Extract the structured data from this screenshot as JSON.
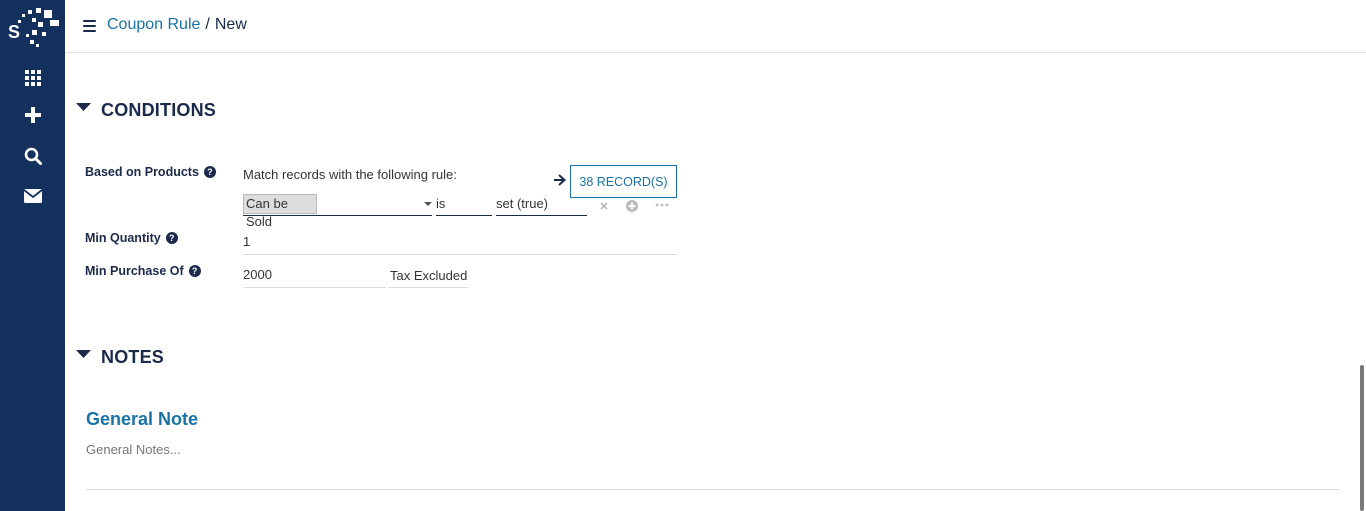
{
  "breadcrumb": {
    "parent": "Coupon Rule",
    "separator": "/",
    "current": "New"
  },
  "sidebar": {
    "items": [
      {
        "icon": "apps-grid-icon"
      },
      {
        "icon": "plus-icon"
      },
      {
        "icon": "search-icon"
      },
      {
        "icon": "envelope-icon"
      }
    ]
  },
  "conditions": {
    "title": "CONDITIONS",
    "based_on_products": {
      "label": "Based on Products",
      "domain_text": "Match records with the following rule:",
      "records_button": "38 RECORD(S)",
      "rule": {
        "field": "Can be Sold",
        "operator": "is",
        "value": "set (true)"
      }
    },
    "min_quantity": {
      "label": "Min Quantity",
      "value": "1"
    },
    "min_purchase": {
      "label": "Min Purchase Of",
      "value": "2000",
      "tax_mode": "Tax Excluded"
    }
  },
  "notes": {
    "title": "NOTES",
    "general_note_title": "General Note",
    "general_note_placeholder": "General Notes..."
  },
  "help_glyph": "?",
  "colors": {
    "sidebar": "#14305c",
    "accent": "#1a73a6",
    "text_dark": "#1b2a4a"
  }
}
